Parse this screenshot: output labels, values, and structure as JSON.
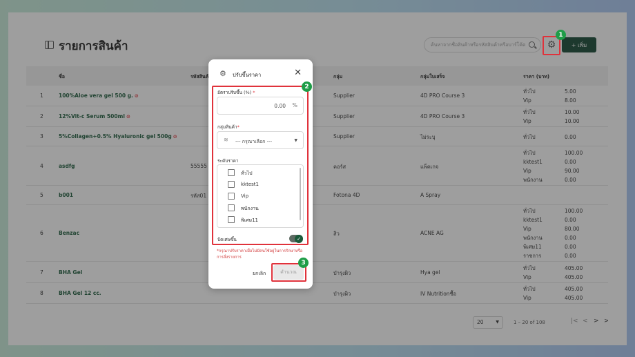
{
  "page": {
    "title": "รายการสินค้า"
  },
  "search": {
    "placeholder": "ค้นหาจากชื่อสินค้าหรือรหัสสินค้าหรือบาร์โค้ด"
  },
  "toolbar": {
    "add_label": "+ เพิ่ม",
    "settings_icon": "gear-icon"
  },
  "table": {
    "headers": [
      "ชื่อ",
      "รหัสสินค้า",
      "กลุ่ม",
      "กลุ่มใบเสร็จ",
      "ราคา (บาท)"
    ],
    "rows": [
      {
        "no": "1",
        "name": "100%Aloe vera gel 500 g.",
        "banned": true,
        "code": "",
        "group": "Supplier",
        "receipt_group": "4D PRO Course 3",
        "prices": [
          {
            "label": "ทั่วไป",
            "value": "5.00"
          },
          {
            "label": "Vip",
            "value": "8.00"
          }
        ]
      },
      {
        "no": "2",
        "name": "12%Vit-c Serum 500ml",
        "banned": true,
        "code": "",
        "group": "Supplier",
        "receipt_group": "4D PRO Course 3",
        "prices": [
          {
            "label": "ทั่วไป",
            "value": "10.00"
          },
          {
            "label": "Vip",
            "value": "10.00"
          }
        ]
      },
      {
        "no": "3",
        "name": "5%Collagen+0.5% Hyaluronic gel 500g",
        "banned": true,
        "code": "",
        "group": "Supplier",
        "receipt_group": "ไม่ระบุ",
        "prices": [
          {
            "label": "ทั่วไป",
            "value": "0.00"
          }
        ]
      },
      {
        "no": "4",
        "name": "asdfg",
        "banned": false,
        "code": "55555",
        "group": "คอร์ส",
        "receipt_group": "แพ็คเกจ",
        "prices": [
          {
            "label": "ทั่วไป",
            "value": "100.00"
          },
          {
            "label": "kktest1",
            "value": "0.00"
          },
          {
            "label": "Vip",
            "value": "90.00"
          },
          {
            "label": "พนักงาน",
            "value": "0.00"
          }
        ]
      },
      {
        "no": "5",
        "name": "b001",
        "banned": false,
        "code": "รหัส01",
        "group": "Fotona 4D",
        "receipt_group": "A Spray",
        "prices": []
      },
      {
        "no": "6",
        "name": "Benzac",
        "banned": false,
        "code": "",
        "group": "สิว",
        "receipt_group": "ACNE AG",
        "prices": [
          {
            "label": "ทั่วไป",
            "value": "100.00"
          },
          {
            "label": "kktest1",
            "value": "0.00"
          },
          {
            "label": "Vip",
            "value": "80.00"
          },
          {
            "label": "พนักงาน",
            "value": "0.00"
          },
          {
            "label": "พิเศษ11",
            "value": "0.00"
          },
          {
            "label": "ราชการ",
            "value": "0.00"
          }
        ]
      },
      {
        "no": "7",
        "name": "BHA Gel",
        "banned": false,
        "code": "",
        "group": "บำรุงผิว",
        "receipt_group": "Hya gel",
        "prices": [
          {
            "label": "ทั่วไป",
            "value": "405.00"
          },
          {
            "label": "Vip",
            "value": "405.00"
          }
        ]
      },
      {
        "no": "8",
        "name": "BHA Gel 12 cc.",
        "banned": false,
        "code": "",
        "group": "บำรุงผิว",
        "receipt_group": "IV Nutritionซื้อ",
        "prices": [
          {
            "label": "ทั่วไป",
            "value": "405.00"
          },
          {
            "label": "Vip",
            "value": "405.00"
          }
        ]
      }
    ]
  },
  "pagination": {
    "per_page": "20",
    "info": "1 – 20 of 108",
    "first": "|<",
    "prev": "<",
    "next": ">",
    "last": ">|"
  },
  "modal": {
    "title": "ปรับขึ้นราคา",
    "rate_label": "อัตราปรับขึ้น (%)",
    "rate_value": "0.00",
    "rate_unit": "%",
    "group_label": "กลุ่มสินค้า",
    "group_placeholder": "--- กรุณาเลือก ---",
    "levels_label": "ระดับราคา",
    "levels": [
      "ทั่วไป",
      "kktest1",
      "Vip",
      "พนักงาน",
      "พิเศษ11"
    ],
    "round_label": "ปัดเศษขึ้น",
    "round_on": true,
    "warning": "*กรุณาปรับราคาเมื่อไม่มีคนใช้อยู่ในการรักษาหรือการสั่งรายการ",
    "cancel_label": "ยกเลิก",
    "submit_label": "คำนวณ",
    "required_mark": "*"
  },
  "annotations": {
    "step1": "1",
    "step2": "2",
    "step3": "3",
    "color": "#e0323b",
    "badge_color": "#1f9d48"
  }
}
